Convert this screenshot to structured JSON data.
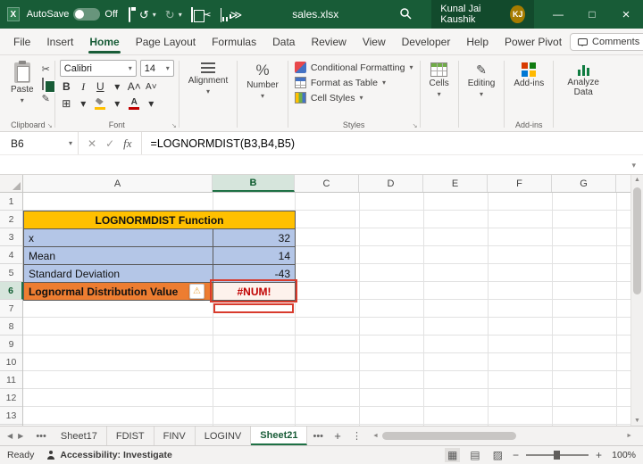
{
  "titlebar": {
    "autosave_label": "AutoSave",
    "autosave_state": "Off",
    "filename": "sales.xlsx",
    "user_name": "Kunal Jai Kaushik",
    "user_initials": "KJ"
  },
  "menubar": {
    "tabs": [
      "File",
      "Insert",
      "Home",
      "Page Layout",
      "Formulas",
      "Data",
      "Review",
      "View",
      "Developer",
      "Help",
      "Power Pivot"
    ],
    "active_tab": "Home",
    "comments_label": "Comments"
  },
  "ribbon": {
    "paste": "Paste",
    "clipboard_group": "Clipboard",
    "font_name": "Calibri",
    "font_size": "14",
    "font_group": "Font",
    "bold": "B",
    "italic": "I",
    "underline": "U",
    "alignment": "Alignment",
    "number": "Number",
    "conditional_formatting": "Conditional Formatting",
    "format_as_table": "Format as Table",
    "cell_styles": "Cell Styles",
    "styles_group": "Styles",
    "cells": "Cells",
    "editing": "Editing",
    "addins": "Add-ins",
    "addins_group": "Add-ins",
    "analyze_data": "Analyze Data"
  },
  "formula_bar": {
    "name_box": "B6",
    "fx_label": "fx",
    "formula": "=LOGNORMDIST(B3,B4,B5)"
  },
  "grid": {
    "columns": [
      "A",
      "B",
      "C",
      "D",
      "E",
      "F",
      "G"
    ],
    "row_numbers": [
      "1",
      "2",
      "3",
      "4",
      "5",
      "6",
      "7",
      "8",
      "9",
      "10",
      "11",
      "12",
      "13"
    ],
    "selected_column": "B",
    "selected_row": "6",
    "selected_cell": "B6",
    "title_cell": "LOGNORMDIST Function",
    "cells": [
      {
        "label": "x",
        "value": "32"
      },
      {
        "label": "Mean",
        "value": "14"
      },
      {
        "label": "Standard Deviation",
        "value": "-43"
      },
      {
        "label": "Lognormal Distribution Value",
        "value": "#NUM!"
      }
    ]
  },
  "sheet_tabs": {
    "tabs": [
      "Sheet17",
      "FDIST",
      "FINV",
      "LOGINV",
      "Sheet21"
    ],
    "active_tab": "Sheet21"
  },
  "status_bar": {
    "ready": "Ready",
    "accessibility": "Accessibility: Investigate",
    "zoom": "100%"
  },
  "colors": {
    "title_fill": "#FFC000",
    "input_fill": "#B4C6E7",
    "result_fill": "#ED7D31",
    "excel_green": "#185C37",
    "accent_green": "#1E7145",
    "annotation_red": "#D83B2D",
    "error_text": "#C00000"
  },
  "icons": {
    "undo": "↺",
    "redo": "↻",
    "chevron_down": "▾",
    "overflow": "≫",
    "minimize": "—",
    "maximize": "□",
    "close": "×",
    "cut": "✂",
    "borders": "⊞",
    "warning": "⚠",
    "percent": "%",
    "grow_font": "A˄",
    "shrink_font": "A˅",
    "cancel": "✕",
    "enter": "✓",
    "more_dots": "⋮",
    "ellipsis": "•••",
    "tab_prev": "◀",
    "tab_next": "▶",
    "up_arrow": "▲",
    "down_arrow": "▼",
    "left_small": "◄",
    "right_small": "►",
    "view_normal": "▦",
    "view_layout": "▤",
    "view_break": "▨",
    "zoom_out": "−",
    "zoom_in": "+",
    "add": "+",
    "pencil": "✎"
  }
}
